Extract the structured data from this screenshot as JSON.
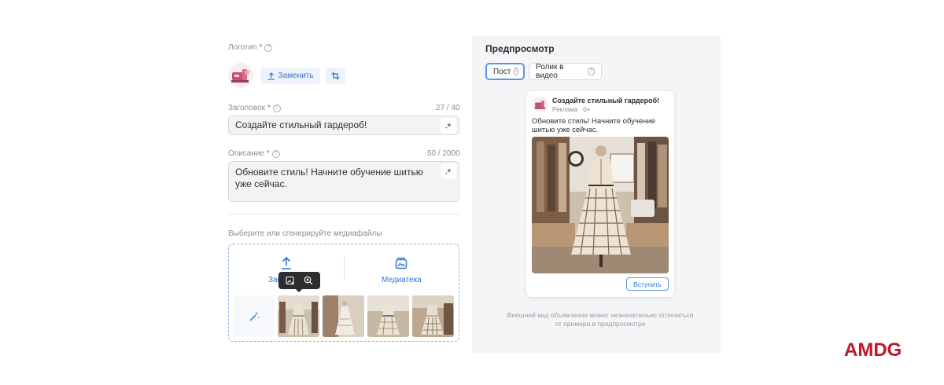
{
  "form": {
    "logo_label": "Логотип",
    "required_mark": "*",
    "replace_label": "Заменить",
    "headline_label": "Заголовок",
    "headline_counter": "27 / 40",
    "headline_value": "Создайте стильный гардероб!",
    "description_label": "Описание",
    "description_counter": "50 / 2000",
    "description_value": "Обновите стиль! Начните обучение шитью уже сейчас.",
    "media_label": "Выберите или сгенерируйте медиафайлы",
    "upload_label": "Загрузить",
    "library_label": "Медиатека"
  },
  "preview": {
    "title": "Предпросмотр",
    "tabs": [
      {
        "label": "Пост",
        "active": true
      },
      {
        "label": "Ролик в видео",
        "active": false
      }
    ],
    "card": {
      "headline": "Создайте стильный гардероб!",
      "meta": "Реклама · 0+",
      "text": "Обновите стиль! Начните обучение шитью уже сейчас.",
      "button": "Вступить"
    },
    "disclaimer": "Внешний вид объявления может незначительно отличаться от примера в предпросмотре"
  },
  "brand": {
    "logo_text": "AMDG",
    "color": "#c1162c"
  },
  "colors": {
    "accent": "#2d74d7",
    "panel_bg": "#f4f5f7"
  }
}
